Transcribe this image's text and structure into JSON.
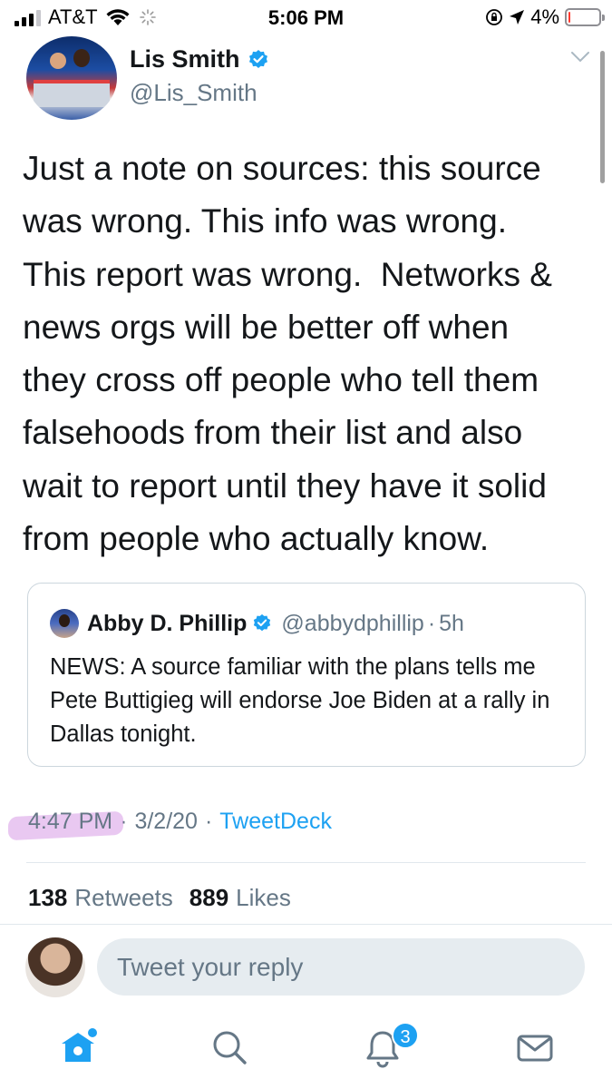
{
  "status_bar": {
    "carrier": "AT&T",
    "time": "5:06 PM",
    "battery_percent": "4%"
  },
  "tweet": {
    "author_name": "Lis Smith",
    "author_handle": "@Lis_Smith",
    "text": "Just a note on sources: this source\nwas wrong. This info was wrong.\nThis report was wrong.  Networks &\nnews orgs will be better off when\nthey cross off people who tell them\nfalsehoods from their list and also\nwait to report until they have it solid\nfrom people who actually know.",
    "time": "4:47 PM",
    "date": "3/2/20",
    "client": "TweetDeck",
    "separator": "·",
    "retweets_count": "138",
    "retweets_label": "Retweets",
    "likes_count": "889",
    "likes_label": "Likes"
  },
  "quoted_tweet": {
    "author_name": "Abby D. Phillip",
    "author_handle": "@abbydphillip",
    "separator": "·",
    "age": "5h",
    "text": "NEWS: A source familiar with the plans tells me Pete Buttigieg will endorse Joe Biden at a rally in Dallas tonight."
  },
  "reply": {
    "placeholder": "Tweet your reply"
  },
  "tabbar": {
    "notifications_badge": "3"
  },
  "colors": {
    "accent": "#1da1f2",
    "secondary_text": "#657786",
    "highlight": "#d79ae6"
  }
}
